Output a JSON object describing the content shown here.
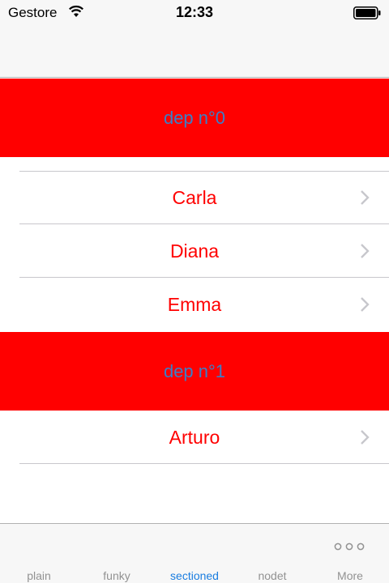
{
  "status_bar": {
    "carrier": "Gestore",
    "time": "12:33",
    "wifi_icon": "wifi-icon",
    "battery_icon": "battery-icon"
  },
  "sections": [
    {
      "header": "dep n°0",
      "rows": [
        {
          "label": "Carla",
          "accessory": "chevron-right-icon"
        },
        {
          "label": "Diana",
          "accessory": "chevron-right-icon"
        },
        {
          "label": "Emma",
          "accessory": "chevron-right-icon"
        }
      ]
    },
    {
      "header": "dep n°1",
      "rows": [
        {
          "label": "Arturo",
          "accessory": "chevron-right-icon"
        }
      ]
    }
  ],
  "tab_bar": {
    "tabs": [
      {
        "label": "plain",
        "active": false
      },
      {
        "label": "funky",
        "active": false
      },
      {
        "label": "sectioned",
        "active": true
      },
      {
        "label": "nodet",
        "active": false
      },
      {
        "label": "More",
        "active": false,
        "icon": "more-dots-icon"
      }
    ]
  },
  "colors": {
    "header_background": "#ff0000",
    "header_text": "#3a7fc8",
    "row_text": "#ff0000",
    "tab_active": "#1a7de0",
    "tab_inactive": "#929292"
  }
}
